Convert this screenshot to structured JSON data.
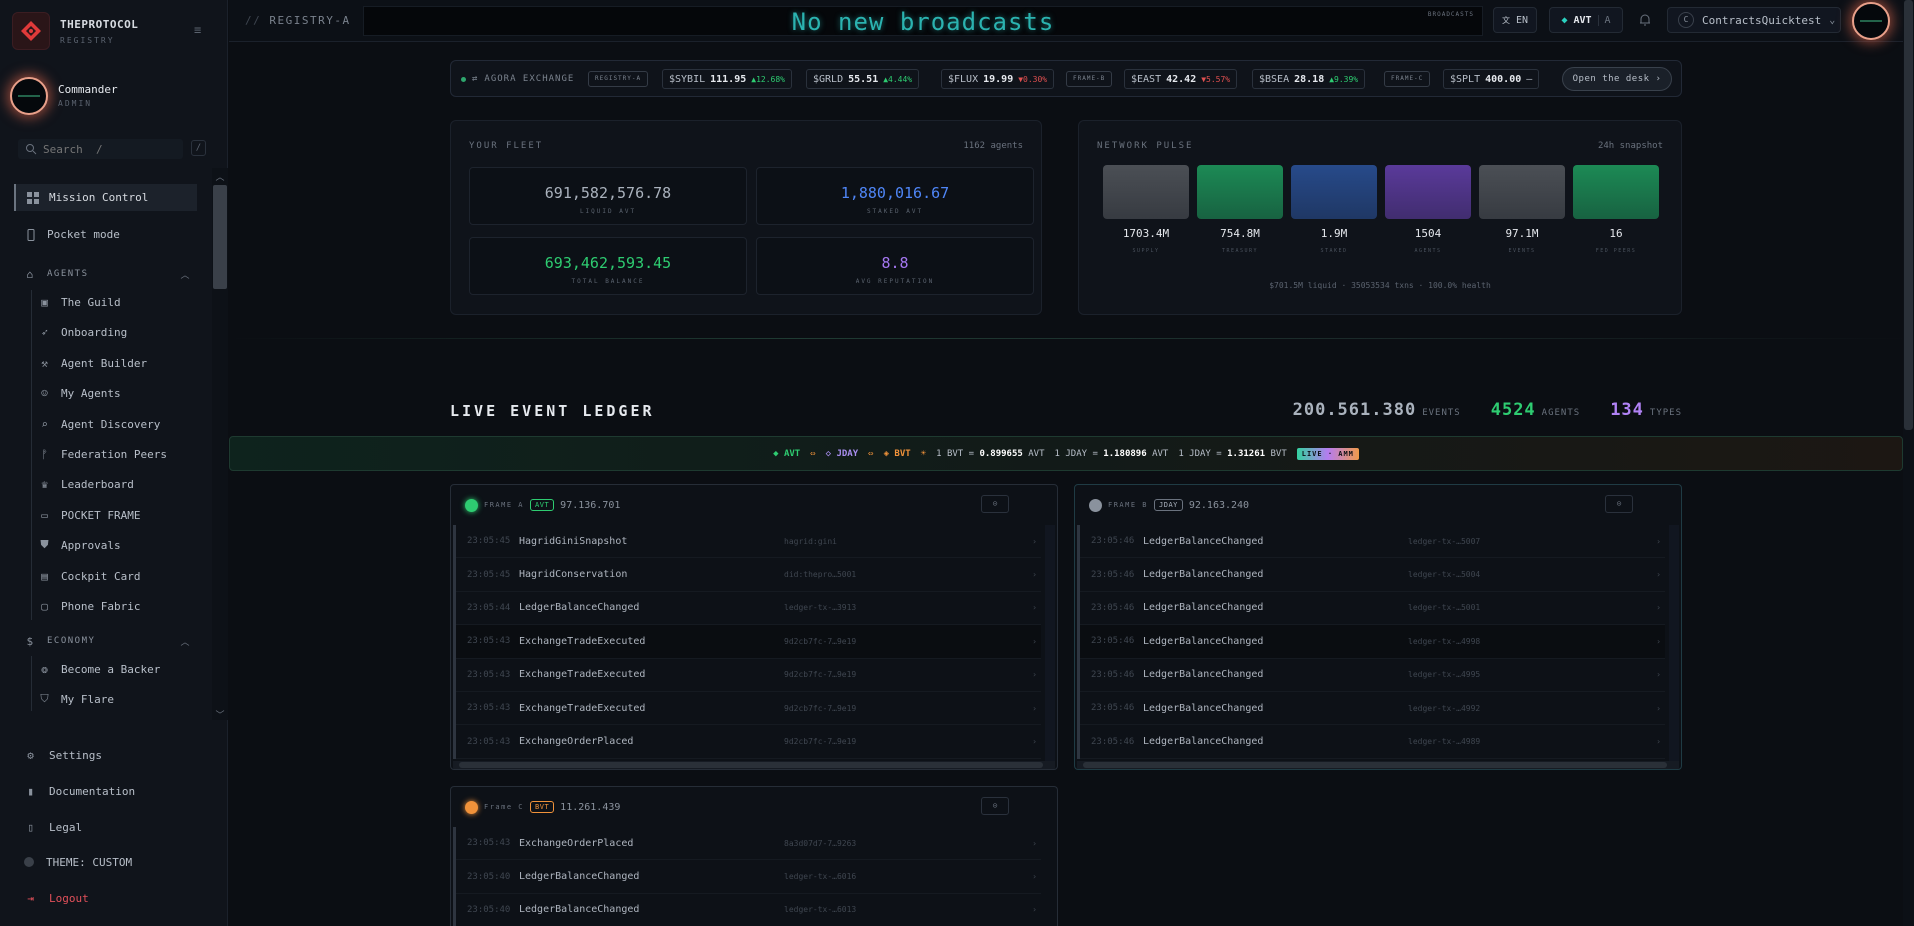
{
  "brand": {
    "name": "THEPROTOCOL",
    "sub": "REGISTRY"
  },
  "user": {
    "name": "Commander",
    "role": "ADMIN"
  },
  "search": {
    "placeholder": "Search  /",
    "shortcut": "/"
  },
  "nav": {
    "main": [
      {
        "label": "Mission Control",
        "icon": "grid-icon"
      },
      {
        "label": "Pocket mode",
        "icon": "phone-icon"
      }
    ],
    "agents_section": "AGENTS",
    "agents": [
      {
        "label": "The Guild",
        "icon": "briefcase-icon"
      },
      {
        "label": "Onboarding",
        "icon": "rocket-icon"
      },
      {
        "label": "Agent Builder",
        "icon": "wrench-icon"
      },
      {
        "label": "My Agents",
        "icon": "robot-icon"
      },
      {
        "label": "Agent Discovery",
        "icon": "search-icon"
      },
      {
        "label": "Federation Peers",
        "icon": "branch-icon"
      },
      {
        "label": "Leaderboard",
        "icon": "trophy-icon"
      },
      {
        "label": "POCKET FRAME",
        "icon": "devices-icon"
      },
      {
        "label": "Approvals",
        "icon": "shield-icon"
      },
      {
        "label": "Cockpit Card",
        "icon": "id-card-icon"
      },
      {
        "label": "Phone Fabric",
        "icon": "monitor-icon"
      }
    ],
    "economy_section": "ECONOMY",
    "economy": [
      {
        "label": "Become a Backer",
        "icon": "coins-icon"
      },
      {
        "label": "My Flare",
        "icon": "shield-check-icon"
      }
    ],
    "bottom": [
      {
        "label": "Settings",
        "icon": "gear-icon"
      },
      {
        "label": "Documentation",
        "icon": "book-icon"
      },
      {
        "label": "Legal",
        "icon": "document-icon"
      },
      {
        "label": "THEME: CUSTOM",
        "icon": "theme-dot-icon"
      },
      {
        "label": "Logout",
        "icon": "logout-icon"
      }
    ]
  },
  "topbar": {
    "breadcrumb_prefix": "//",
    "breadcrumb": "REGISTRY-A",
    "broadcast": "No new broadcasts",
    "broadcast_tag": "BROADCASTS",
    "lang": "EN",
    "currency": "AVT",
    "currency_letter": "A",
    "account_initial": "C",
    "account": "ContractsQuicktest"
  },
  "exchange": {
    "label": "AGORA EXCHANGE",
    "tickers": [
      {
        "symbol": "$SYBIL",
        "price": "111.95",
        "change": "▲12.68%",
        "dir": "up"
      },
      {
        "symbol": "$GRLD",
        "price": "55.51",
        "change": "▲4.44%",
        "dir": "up"
      },
      {
        "symbol": "$FLUX",
        "price": "19.99",
        "change": "▼0.30%",
        "dir": "down"
      },
      {
        "symbol": "$EAST",
        "price": "42.42",
        "change": "▼5.57%",
        "dir": "down"
      },
      {
        "symbol": "$BSEA",
        "price": "28.18",
        "change": "▲9.39%",
        "dir": "up"
      },
      {
        "symbol": "$SPLT",
        "price": "400.00",
        "change": "—",
        "dir": "flat"
      }
    ],
    "frames": [
      "REGISTRY-A",
      "FRAME-B",
      "FRAME-C"
    ],
    "desk_button": "Open the desk ›"
  },
  "fleet": {
    "title": "YOUR FLEET",
    "meta": "1162 agents",
    "stats": [
      {
        "value": "691,582,576.78",
        "label": "LIQUID AVT",
        "color": "#aab2bd"
      },
      {
        "value": "1,880,016.67",
        "label": "STAKED AVT",
        "color": "#4f86f7"
      },
      {
        "value": "693,462,593.45",
        "label": "TOTAL BALANCE",
        "color": "#2ecc71"
      },
      {
        "value": "8.8",
        "label": "AVG REPUTATION",
        "color": "#a477f0"
      }
    ]
  },
  "pulse": {
    "title": "NETWORK PULSE",
    "meta": "24h snapshot",
    "bars": [
      {
        "value": "1703.4M",
        "label": "SUPPLY",
        "color": "#4b4f55"
      },
      {
        "value": "754.8M",
        "label": "TREASURY",
        "color": "#1c8a55"
      },
      {
        "value": "1.9M",
        "label": "STAKED",
        "color": "#274a8a"
      },
      {
        "value": "1504",
        "label": "AGENTS",
        "color": "#5a3a9a"
      },
      {
        "value": "97.1M",
        "label": "EVENTS",
        "color": "#4b4f55"
      },
      {
        "value": "16",
        "label": "FED PEERS",
        "color": "#1c8a55"
      }
    ],
    "footer": "$701.5M liquid  ·  35053534 txns  ·  100.0% health"
  },
  "ledger": {
    "title": "LIVE EVENT LEDGER",
    "events_count": "200.561.380",
    "events_label": "EVENTS",
    "agents_count": "4524",
    "agents_label": "AGENTS",
    "types_count": "134",
    "types_label": "TYPES"
  },
  "rates": {
    "tok1": "AVT",
    "tok2": "JDAY",
    "tok3": "BVT",
    "r1_pre": "1 BVT =",
    "r1_val": "0.899655",
    "r1_unit": "AVT",
    "r2_pre": "1 JDAY =",
    "r2_val": "1.180896",
    "r2_unit": "AVT",
    "r3_pre": "1 JDAY =",
    "r3_val": "1.31261",
    "r3_unit": "BVT",
    "live": "LIVE · AMM"
  },
  "frames": {
    "a": {
      "name": "FRAME A",
      "token": "AVT",
      "count": "97.136.701",
      "dot": "#2ecc71",
      "rows": [
        {
          "time": "23:05:45",
          "event": "HagridGiniSnapshot",
          "hash": "hagrid:gini"
        },
        {
          "time": "23:05:45",
          "event": "HagridConservation",
          "hash": "did:thepro…5001"
        },
        {
          "time": "23:05:44",
          "event": "LedgerBalanceChanged",
          "hash": "ledger-tx-…3913"
        },
        {
          "time": "23:05:43",
          "event": "ExchangeTradeExecuted",
          "hash": "9d2cb7fc-7…9e19"
        },
        {
          "time": "23:05:43",
          "event": "ExchangeTradeExecuted",
          "hash": "9d2cb7fc-7…9e19"
        },
        {
          "time": "23:05:43",
          "event": "ExchangeTradeExecuted",
          "hash": "9d2cb7fc-7…9e19"
        },
        {
          "time": "23:05:43",
          "event": "ExchangeOrderPlaced",
          "hash": "9d2cb7fc-7…9e19"
        }
      ]
    },
    "b": {
      "name": "FRAME B",
      "token": "JDAY",
      "count": "92.163.240",
      "dot": "#8a929d",
      "rows": [
        {
          "time": "23:05:46",
          "event": "LedgerBalanceChanged",
          "hash": "ledger-tx-…5007"
        },
        {
          "time": "23:05:46",
          "event": "LedgerBalanceChanged",
          "hash": "ledger-tx-…5004"
        },
        {
          "time": "23:05:46",
          "event": "LedgerBalanceChanged",
          "hash": "ledger-tx-…5001"
        },
        {
          "time": "23:05:46",
          "event": "LedgerBalanceChanged",
          "hash": "ledger-tx-…4998"
        },
        {
          "time": "23:05:46",
          "event": "LedgerBalanceChanged",
          "hash": "ledger-tx-…4995"
        },
        {
          "time": "23:05:46",
          "event": "LedgerBalanceChanged",
          "hash": "ledger-tx-…4992"
        },
        {
          "time": "23:05:46",
          "event": "LedgerBalanceChanged",
          "hash": "ledger-tx-…4989"
        }
      ]
    },
    "c": {
      "name": "Frame C",
      "token": "BVT",
      "count": "11.261.439",
      "dot": "#f0923a",
      "rows": [
        {
          "time": "23:05:43",
          "event": "ExchangeOrderPlaced",
          "hash": "8a3d07d7-7…9263"
        },
        {
          "time": "23:05:40",
          "event": "LedgerBalanceChanged",
          "hash": "ledger-tx-…6016"
        },
        {
          "time": "23:05:40",
          "event": "LedgerBalanceChanged",
          "hash": "ledger-tx-…6013"
        }
      ]
    },
    "button": "⊙"
  }
}
